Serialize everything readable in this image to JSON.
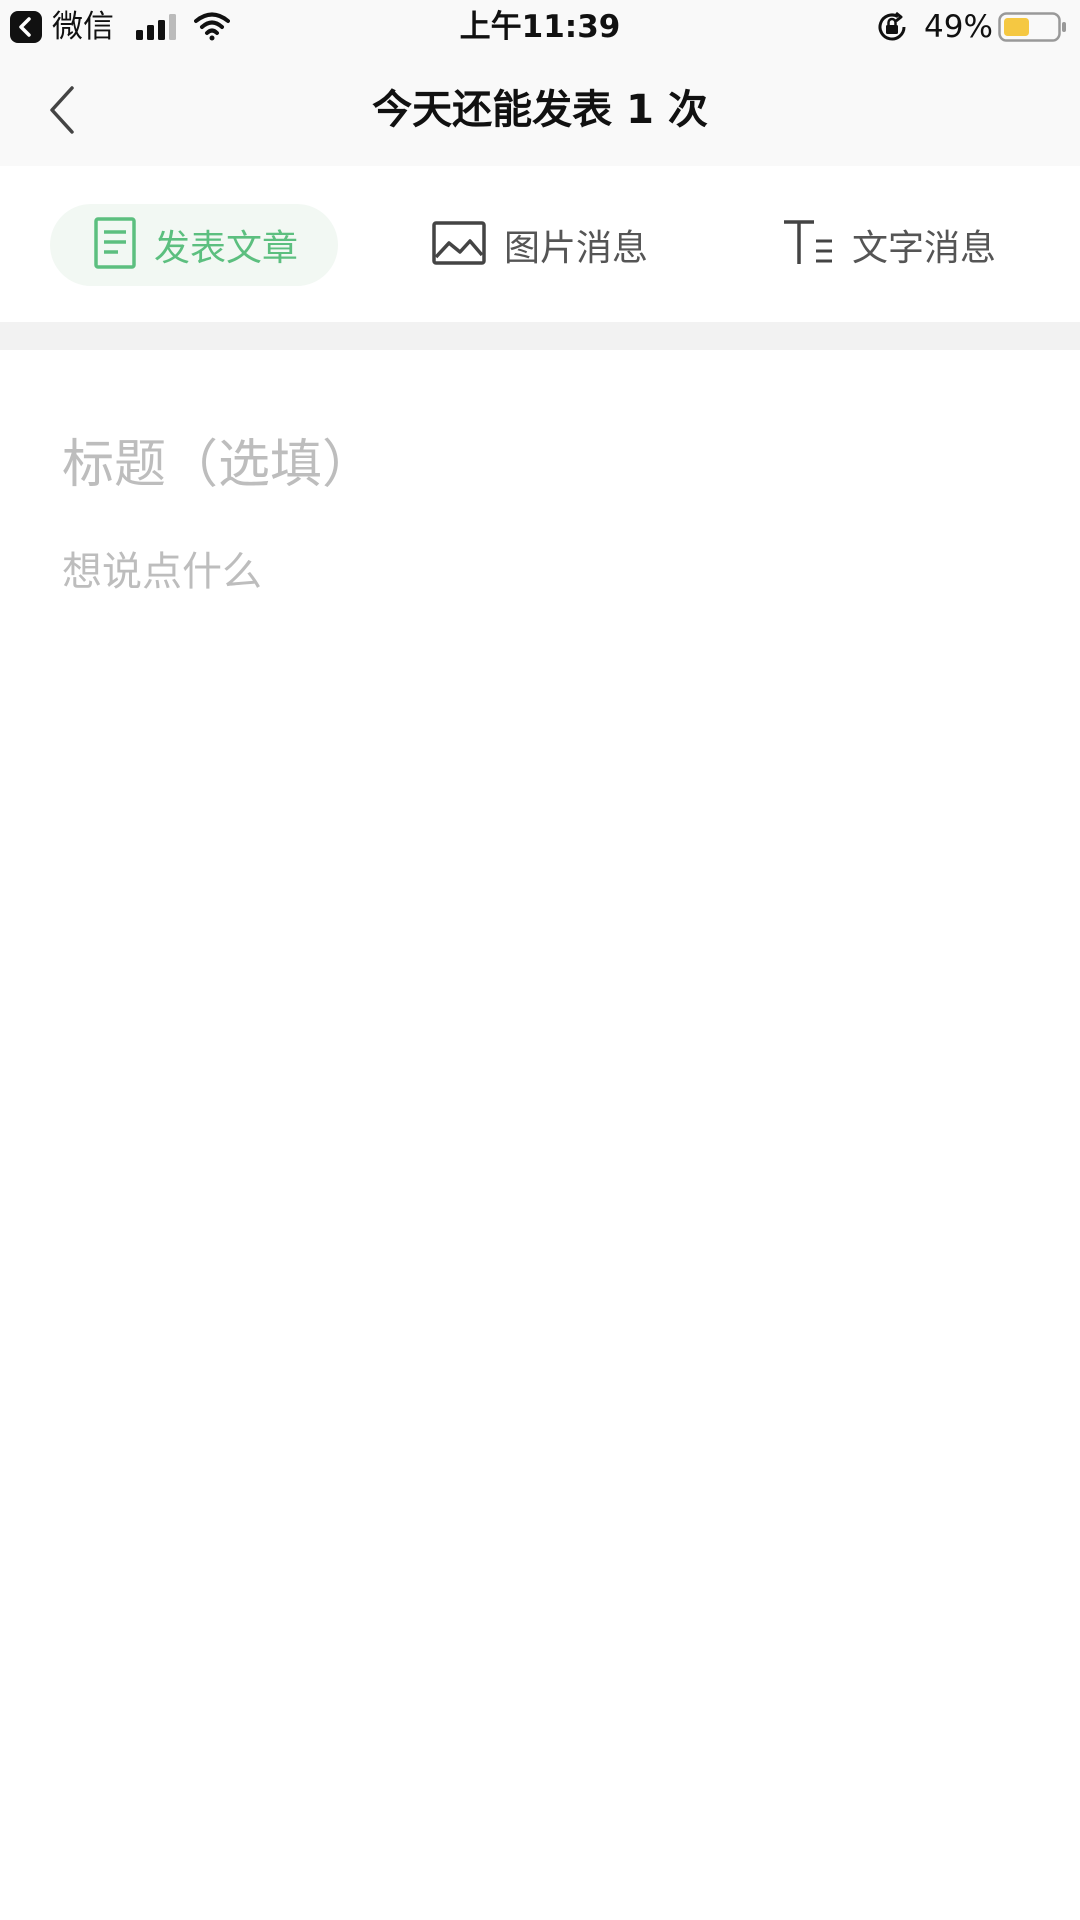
{
  "status_bar": {
    "back_app": "微信",
    "time": "上午11:39",
    "battery_percent": "49%",
    "battery_level": 0.49,
    "battery_color": "#f5c842",
    "icons": [
      "back-app-icon",
      "signal-icon",
      "wifi-icon",
      "orientation-lock-icon",
      "battery-icon"
    ]
  },
  "nav": {
    "title": "今天还能发表 1 次",
    "back_icon": "chevron-left-icon"
  },
  "tabs": [
    {
      "label": "发表文章",
      "icon": "document-icon",
      "active": true
    },
    {
      "label": "图片消息",
      "icon": "image-icon",
      "active": false
    },
    {
      "label": "文字消息",
      "icon": "text-format-icon",
      "active": false
    }
  ],
  "editor": {
    "title_placeholder": "标题（选填）",
    "title_value": "",
    "body_placeholder": "想说点什么",
    "body_value": ""
  },
  "colors": {
    "accent": "#5cbf7f",
    "active_tab_bg": "#f2f8f3",
    "placeholder": "#bdbdbd",
    "icon_gray": "#444444"
  }
}
